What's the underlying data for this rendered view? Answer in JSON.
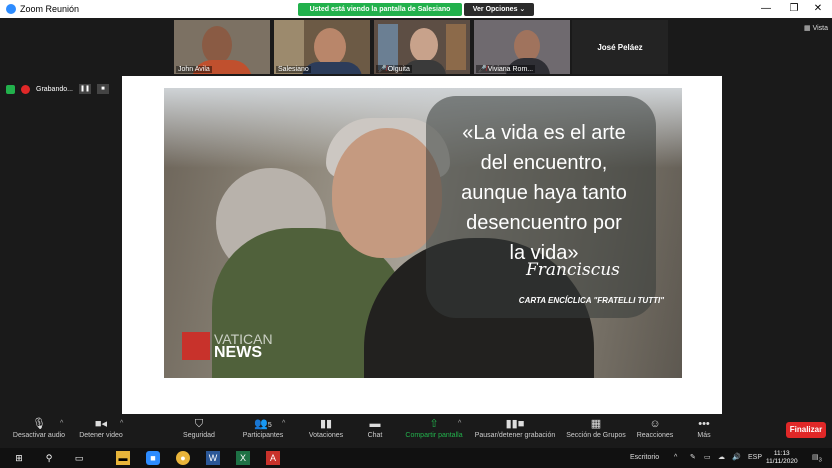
{
  "window": {
    "title": "Zoom Reunión",
    "controls": [
      "—",
      "❐",
      "✕"
    ]
  },
  "share_banner": {
    "text": "Usted está viendo la pantalla de Salesiano",
    "view_options": "Ver Opciones ⌄"
  },
  "participants": [
    {
      "name": "John Avila",
      "mic_muted": false,
      "bg": "#7c7163",
      "face": "#8a5b44"
    },
    {
      "name": "Salesiano",
      "mic_muted": false,
      "bg": "#6c5a45",
      "face": "#b9866a"
    },
    {
      "name": "Olguita",
      "mic_muted": true,
      "bg": "#5d4e44",
      "face": "#c8a28b"
    },
    {
      "name": "Viviana Rom...",
      "mic_muted": true,
      "bg": "#6f6a6f",
      "face": "#a0735d"
    }
  ],
  "active_speaker": "José Peláez",
  "view_label": "Vista",
  "recording": {
    "label": "Grabando..."
  },
  "slide": {
    "quote_lines": [
      "«La vida es el arte",
      "del encuentro,",
      "aunque haya tanto",
      "desencuentro por",
      "la vida»"
    ],
    "signature": "Franciscus",
    "source": "CARTA ENCÍCLICA \"FRATELLI TUTTI\"",
    "logo_line1": "VATICAN",
    "logo_line2": "NEWS"
  },
  "toolbar": {
    "items": [
      {
        "label": "Desactivar audio",
        "icon": "microphone-icon",
        "glyph": "🎙"
      },
      {
        "label": "Detener video",
        "icon": "video-camera-icon",
        "glyph": "■◂"
      },
      {
        "label": "Seguridad",
        "icon": "shield-icon",
        "glyph": "⛉"
      },
      {
        "label": "Participantes",
        "icon": "participants-icon",
        "glyph": "👥",
        "count": "5"
      },
      {
        "label": "Votaciones",
        "icon": "polls-icon",
        "glyph": "▮▮"
      },
      {
        "label": "Chat",
        "icon": "chat-icon",
        "glyph": "▬"
      },
      {
        "label": "Compartir pantalla",
        "icon": "share-screen-icon",
        "glyph": "⇧"
      },
      {
        "label": "Pausar/detener grabación",
        "icon": "pause-record-icon",
        "glyph": "▮▮■"
      },
      {
        "label": "Sección de Grupos",
        "icon": "breakout-rooms-icon",
        "glyph": "▦"
      },
      {
        "label": "Reacciones",
        "icon": "reactions-icon",
        "glyph": "☺"
      },
      {
        "label": "Más",
        "icon": "more-icon",
        "glyph": "•••"
      }
    ],
    "end_label": "Finalizar"
  },
  "taskbar": {
    "desktop_label": "Escritorio",
    "language": "ESP",
    "time": "11:13",
    "date": "11/11/2020",
    "notifications": "3"
  }
}
